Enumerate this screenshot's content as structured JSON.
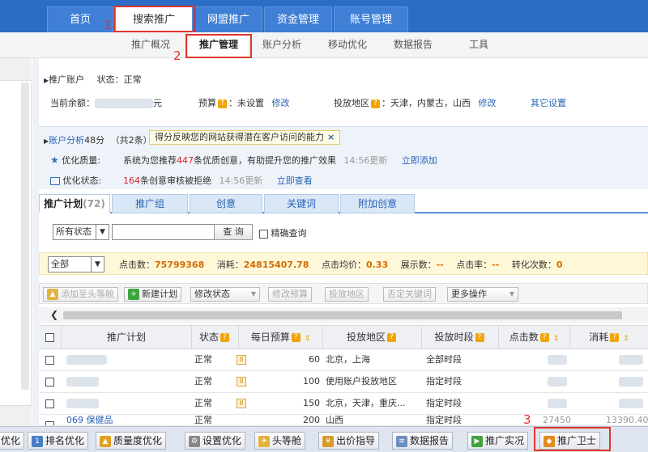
{
  "main_tabs": [
    "首页",
    "搜索推广",
    "网盟推广",
    "资金管理",
    "账号管理"
  ],
  "sub_nav": [
    "推广概况",
    "推广管理",
    "账户分析",
    "移动优化",
    "数据报告",
    "工具"
  ],
  "annotations": [
    "1",
    "2",
    "3"
  ],
  "account": {
    "title": "推广账户",
    "status_label": "状态：",
    "status_value": "正常",
    "balance_label": "当前余额：",
    "balance_unit": "元",
    "budget_label": "预算",
    "budget_value": "：未设置",
    "budget_edit": "修改",
    "region_label": "投放地区",
    "region_value": "：天津，内蒙古，山西",
    "region_edit": "修改",
    "other_settings": "其它设置"
  },
  "analysis": {
    "title": "账户分析",
    "score": "48分",
    "count": "（共2条）",
    "tip": "得分反映您的网站获得潜在客户访问的能力",
    "tip_close": "×",
    "items": [
      {
        "label": "优化质量:",
        "pre": "系统为您推荐",
        "num": "447",
        "post": "条优质创意，有助提升您的推广效果",
        "time": "14:56更新",
        "action": "立即添加"
      },
      {
        "label": "优化状态:",
        "pre": "",
        "num": "164",
        "post": "条创意审核被拒绝",
        "time": "14:56更新",
        "action": "立即查看"
      }
    ]
  },
  "content_tabs": [
    {
      "label": "推广计划",
      "count": "(72)"
    },
    {
      "label": "推广组"
    },
    {
      "label": "创意"
    },
    {
      "label": "关键词"
    },
    {
      "label": "附加创意"
    }
  ],
  "filter": {
    "status_select": "所有状态",
    "query_button": "查 询",
    "exact_label": "精确查询"
  },
  "stats": {
    "range_select": "全部",
    "clicks_label": "点击数：",
    "clicks": "75799368",
    "cost_label": "消耗：",
    "cost": "24815407.78",
    "avg_label": "点击均价：",
    "avg": "0.33",
    "impr_label": "展示数：",
    "impr": "--",
    "ctr_label": "点击率：",
    "ctr": "--",
    "conv_label": "转化次数：",
    "conv": "0"
  },
  "toolbar": [
    "添加至头等舱",
    "新建计划",
    "修改状态",
    "修改预算",
    "投放地区",
    "否定关键词",
    "更多操作"
  ],
  "table": {
    "headers": [
      "推广计划",
      "状态",
      "每日预算",
      "投放地区",
      "投放时段",
      "点击数",
      "消耗"
    ],
    "rows": [
      {
        "name": "",
        "status": "正常",
        "budget": "60",
        "region": "北京，上海",
        "time": "全部时段",
        "clicks": "",
        "cost": ""
      },
      {
        "name": "",
        "status": "正常",
        "budget": "100",
        "region": "使用账户投放地区",
        "time": "指定时段",
        "clicks": "",
        "cost": ""
      },
      {
        "name": "",
        "status": "正常",
        "budget": "150",
        "region": "北京，天津，重庆...",
        "time": "指定时段",
        "clicks": "",
        "cost": ""
      },
      {
        "name": "069 保健品",
        "status": "正常",
        "budget": "200",
        "region": "山西",
        "time": "指定时段",
        "clicks": "27450",
        "cost": "13390.40"
      }
    ]
  },
  "bottom_bar": [
    "优化",
    "排名优化",
    "质量度优化",
    "设置优化",
    "头等舱",
    "出价指导",
    "数据报告",
    "推广实况",
    "推广卫士"
  ]
}
